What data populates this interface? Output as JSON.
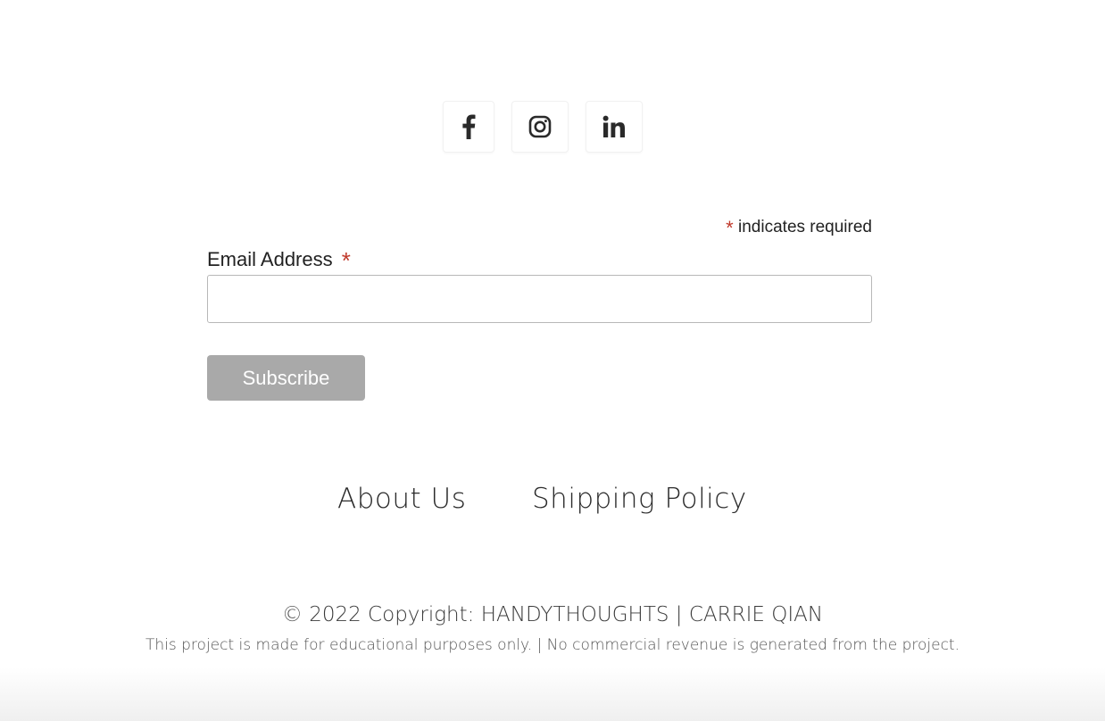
{
  "social": {
    "facebook": {
      "icon": "facebook-icon"
    },
    "instagram": {
      "icon": "instagram-icon"
    },
    "linkedin": {
      "icon": "linkedin-icon"
    }
  },
  "form": {
    "required_asterisk": "*",
    "required_note": "indicates required",
    "email_label": "Email Address",
    "email_asterisk": "*",
    "email_value": "",
    "email_placeholder": "",
    "subscribe_label": "Subscribe",
    "accent_color": "#c0392b",
    "button_color": "#a9a9a9"
  },
  "footer": {
    "links": [
      {
        "label": "About Us"
      },
      {
        "label": "Shipping Policy"
      }
    ],
    "copyright": "© 2022 Copyright: HANDYTHOUGHTS | CARRIE QIAN",
    "disclaimer": "This project is made for educational purposes only. | No commercial revenue is generated from the project."
  }
}
